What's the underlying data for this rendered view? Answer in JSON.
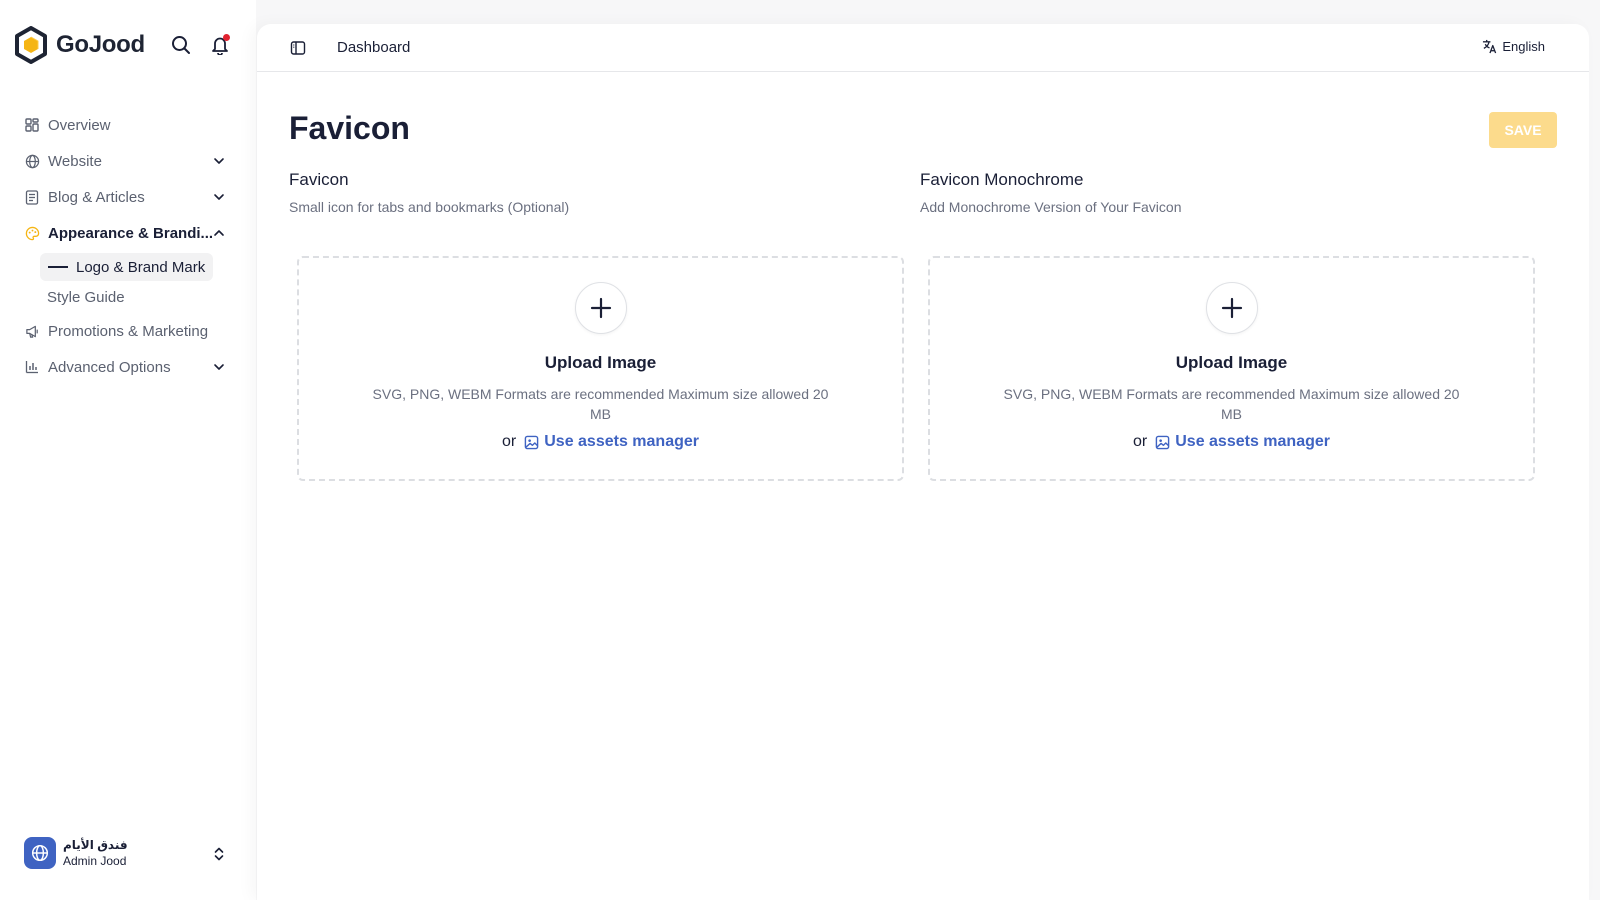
{
  "brand": {
    "name": "GoJood",
    "accent": "#f5b514",
    "dark": "#1e2433"
  },
  "sidebar": {
    "items": [
      {
        "label": "Overview",
        "icon": "grid-icon"
      },
      {
        "label": "Website",
        "icon": "globe-icon"
      },
      {
        "label": "Blog & Articles",
        "icon": "document-icon"
      },
      {
        "label": "Appearance & Brandi...",
        "icon": "palette-icon"
      },
      {
        "label": "Promotions & Marketing",
        "icon": "megaphone-icon"
      },
      {
        "label": "Advanced Options",
        "icon": "bar-chart-icon"
      }
    ],
    "subitems": [
      {
        "label": "Logo & Brand Mark"
      },
      {
        "label": "Style Guide"
      }
    ]
  },
  "account": {
    "name": "فندق الأيام",
    "role": "Admin Jood"
  },
  "topbar": {
    "breadcrumb": "Dashboard",
    "language": "English"
  },
  "page": {
    "title": "Favicon",
    "save_label": "SAVE"
  },
  "fields": [
    {
      "label": "Favicon",
      "help": "Small icon for tabs and bookmarks (Optional)",
      "upload_title": "Upload Image",
      "upload_desc": "SVG, PNG, WEBM Formats are recommended Maximum size allowed 20 MB",
      "or_text": "or",
      "assets_label": "Use assets manager"
    },
    {
      "label": "Favicon Monochrome",
      "help": "Add Monochrome Version of Your Favicon",
      "upload_title": "Upload Image",
      "upload_desc": "SVG, PNG, WEBM Formats are recommended Maximum size allowed 20 MB",
      "or_text": "or",
      "assets_label": "Use assets manager"
    }
  ],
  "colors": {
    "link": "#3f63c2",
    "save_disabled": "#fcdb8c",
    "notification": "#e0212f"
  }
}
